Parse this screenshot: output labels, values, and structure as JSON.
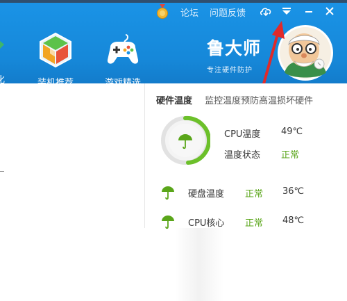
{
  "titlebar": {
    "forum_label": "论坛",
    "feedback_label": "问题反馈"
  },
  "nav": {
    "edge_label": "化",
    "items": [
      {
        "label": "装机推荐",
        "icon": "cube-icon"
      },
      {
        "label": "游戏精选",
        "icon": "gamepad-icon"
      }
    ]
  },
  "brand": {
    "title": "鲁大师",
    "subtitle": "专注硬件防护"
  },
  "panel": {
    "title": "硬件温度",
    "description": "监控温度预防高温损坏硬件",
    "cpu_temp_label": "CPU温度",
    "cpu_temp_value": "49℃",
    "temp_status_label": "温度状态",
    "temp_status_value": "正常",
    "rows": [
      {
        "name": "硬盘温度",
        "status": "正常",
        "temp": "36℃"
      },
      {
        "name": "CPU核心",
        "status": "正常",
        "temp": "48℃"
      }
    ]
  },
  "colors": {
    "header_blue": "#1688d9",
    "ok_green": "#5aa61a",
    "arrow_red": "#e02a2a"
  }
}
